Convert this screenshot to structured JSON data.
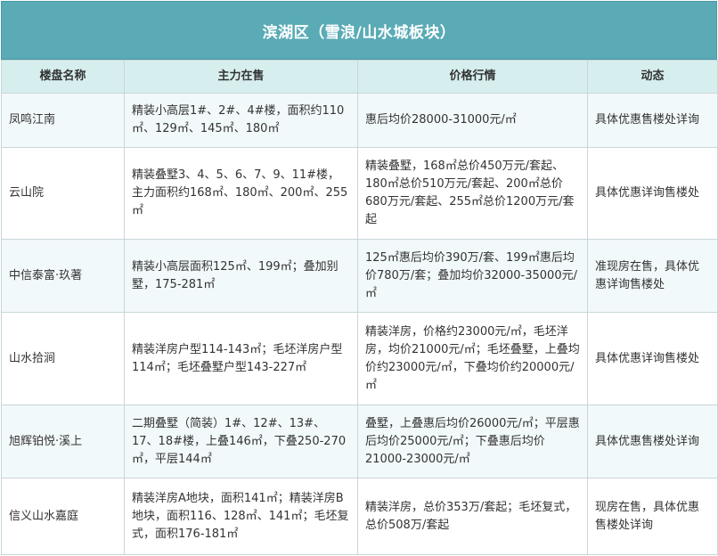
{
  "title": "滨湖区（雪浪/山水城板块）",
  "headers": [
    "楼盘名称",
    "主力在售",
    "价格行情",
    "动态"
  ],
  "rows": [
    {
      "name": "凤鸣江南",
      "product": "精装小高层1#、2#、4#楼，面积约110㎡、129㎡、145㎡、180㎡",
      "price": "惠后均价28000-31000元/㎡",
      "status": "具体优惠售楼处详询"
    },
    {
      "name": "云山院",
      "product": "精装叠墅3、4、5、6、7、9、11#楼，主力面积约168㎡、180㎡、200㎡、255㎡",
      "price": "精装叠墅，168㎡总价450万元/套起、180㎡总价510万元/套起、200㎡总价680万元/套起、255㎡总价1200万元/套起",
      "status": "具体优惠详询售楼处"
    },
    {
      "name": "中信泰富·玖著",
      "product": "精装小高层面积125㎡、199㎡；叠加别墅，175-281㎡",
      "price": "125㎡惠后均价390万/套、199㎡惠后均价780万/套；叠加均价32000-35000元/㎡",
      "status": "准现房在售，具体优惠详询售楼处"
    },
    {
      "name": "山水拾涧",
      "product": "精装洋房户型114-143㎡；毛坯洋房户型114㎡；毛坯叠墅户型143-227㎡",
      "price": "精装洋房，价格约23000元/㎡，毛坯洋房，均价21000元/㎡；毛坯叠墅，上叠均价约23000元/㎡，下叠均价约20000元/㎡",
      "status": "具体优惠详询售楼处"
    },
    {
      "name": "旭辉铂悦·溪上",
      "product": "二期叠墅（简装）1#、12#、13#、17、18#楼，上叠146㎡，下叠250-270㎡，平层144㎡",
      "price": "叠墅，上叠惠后均价26000元/㎡；平层惠后均价25000元/㎡；下叠惠后均价21000-23000元/㎡",
      "status": "具体优惠售楼处详询"
    },
    {
      "name": "信义山水嘉庭",
      "product": "精装洋房A地块，面积141㎡；精装洋房B地块，面积116、128㎡、141㎡；毛坯复式，面积176-181㎡",
      "price": "精装洋房，总价353万/套起；毛坯复式，总价508万/套起",
      "status": "现房在售，具体优惠售楼处详询"
    }
  ],
  "colors": {
    "title_bg": "#5aabb6",
    "header_bg": "#d7eeef",
    "stripe_bg": "#f2f9fa",
    "border": "#c9d6d8"
  }
}
